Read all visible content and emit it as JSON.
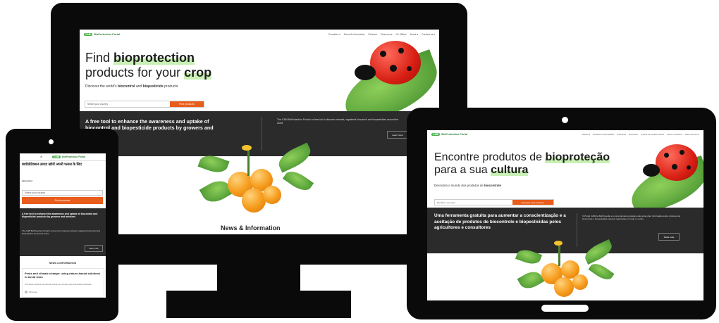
{
  "brand": {
    "badge": "CABI",
    "name": "BioProtection Portal"
  },
  "desktop": {
    "nav": [
      "Countries ▾",
      "News & Information",
      "Partners",
      "Resources",
      "Go Offline",
      "About ▾",
      "Contact us ▾"
    ],
    "title_1": "Find ",
    "title_hl1": "bioprotection",
    "title_2": "products for your ",
    "title_hl2": "crop",
    "subtitle_1": "Discover the world's ",
    "subtitle_hl1": "biocontrol",
    "subtitle_2": " and ",
    "subtitle_hl2": "biopesticide",
    "subtitle_3": " products",
    "search_placeholder": "Select your country",
    "search_button": "Find products",
    "band_title": "A free tool to enhance the awareness and uptake of biocontrol and biopesticide products by growers and advisors",
    "band_text": "The CABI BioProtection Portal is a free tool to discover relevant, registered biocontrol and biopesticides around the world.",
    "band_button": "Learn more",
    "section_title": "News & Information"
  },
  "tablet": {
    "nav": [
      "Países ▾",
      "Notícias e informações",
      "Parceiros",
      "Recursos",
      "A parte de versão off-line",
      "Sobre o Portal ▾",
      "Fale conosco ▾"
    ],
    "title_1": "Encontre produtos de ",
    "title_hl1": "bioproteção",
    "title_2": "para a sua ",
    "title_hl2": "cultura",
    "subtitle_1": "Descubra o mundo dos produtos de ",
    "subtitle_hl1": "biocontrole",
    "search_placeholder": "Escolha o seu país",
    "search_button": "Encontre seus produtos",
    "band_title": "Uma ferramenta gratuita para aumentar a conscientização e a aceitação de produtos de biocontrole e biopesticidas pelos agricultores e consultores",
    "band_text": "O Portal CABI de BioProteção é uma ferramenta gratuita onde pode obter informação sobre produtos de biocontrole e biopesticidas naturais registrados em todo o mundo.",
    "band_button": "Saiba mais"
  },
  "phone": {
    "brand": "BioProtection Portal",
    "title": "बायोप्रोटेक्शन उत्पाद खोजें अपनी फसल के लिए",
    "subtitle_hl1": "biocontrol",
    "search_placeholder": "Select your country",
    "search_button": "Find products",
    "band_title": "A free tool to enhance the awareness and uptake of biocontrol and biopesticide products by growers and advisors",
    "band_text": "The CABI BioProtection Portal is a free tool to discover relevant, registered biocontrol and biopesticides around the world.",
    "band_button": "Learn more",
    "news_header": "NEWS & INFORMATION",
    "news_title": "Pests and climate change: using nature-based solutions to avoid risks",
    "news_text": "This article explores how climate change can increase pest and disease outbreaks.",
    "news_author": "Phil Lewis"
  },
  "colors": {
    "accent": "#e85d1c",
    "highlight": "#c9f0b4",
    "band": "#2b2b2b",
    "brand_green": "#4caf50"
  }
}
